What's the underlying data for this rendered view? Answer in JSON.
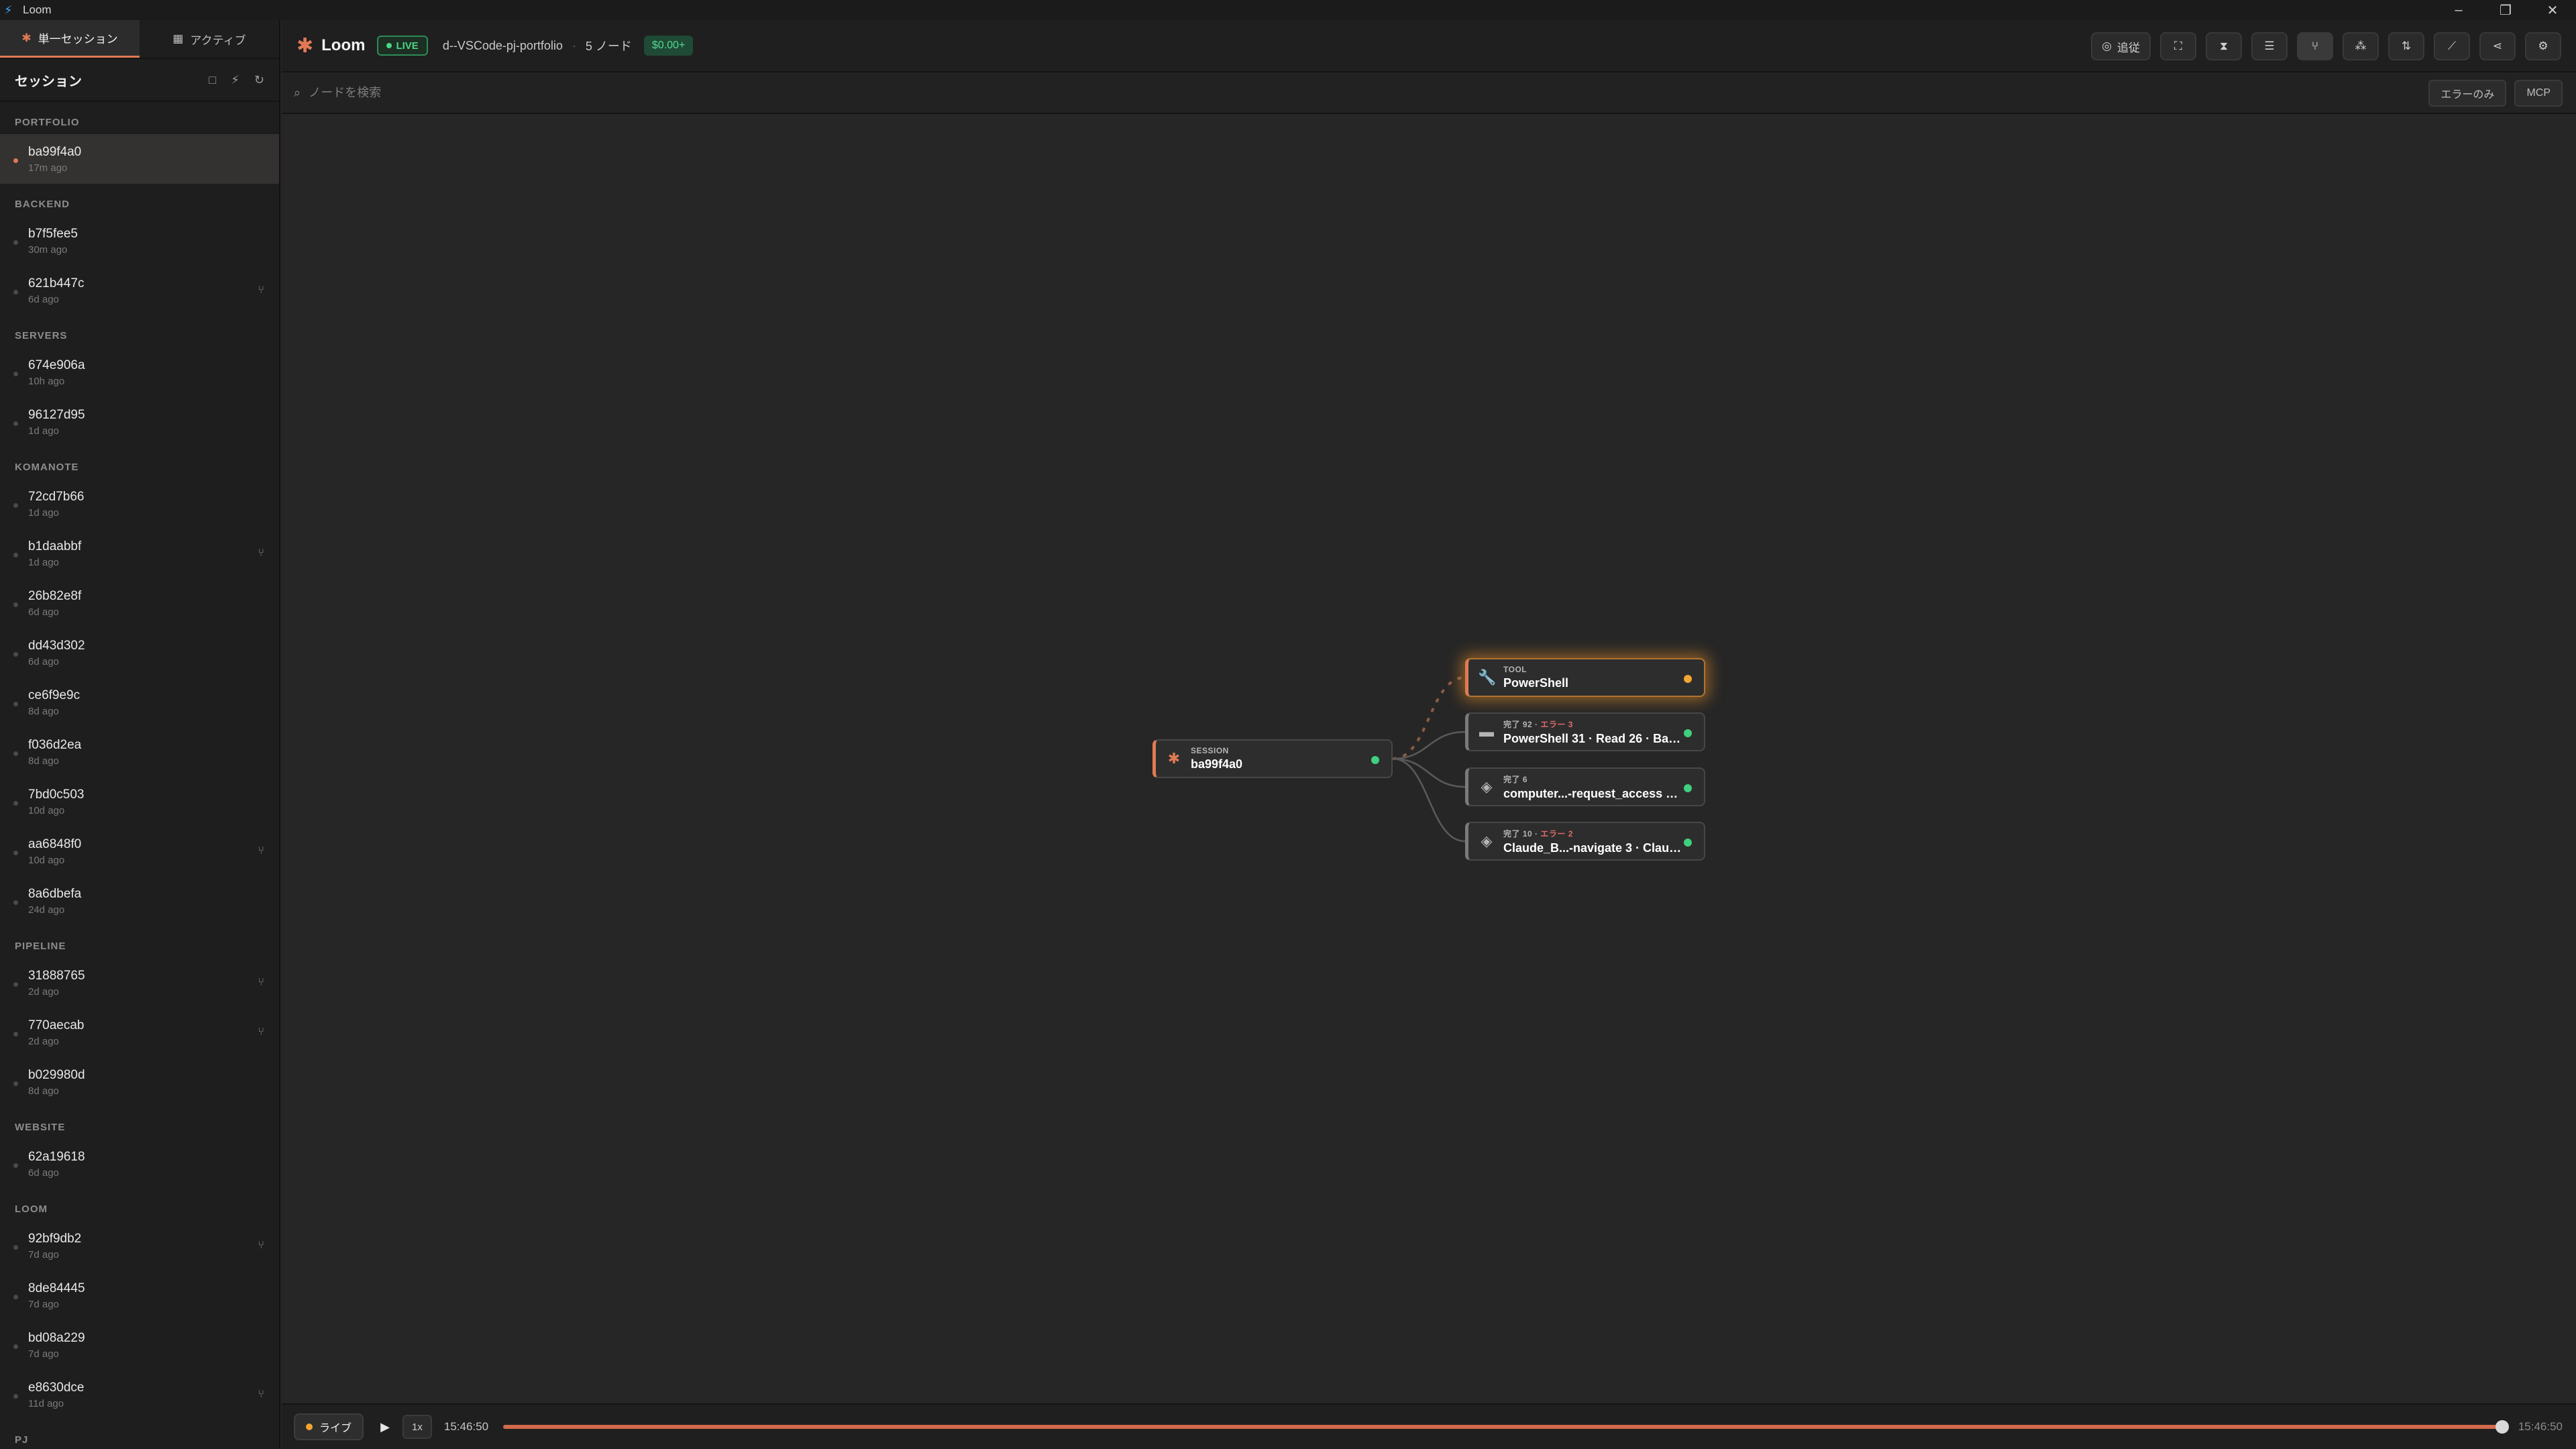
{
  "window": {
    "title": "Loom",
    "controls": [
      "–",
      "❐",
      "✕"
    ]
  },
  "sidebar": {
    "tabs": [
      {
        "label": "単一セッション",
        "icon": "✱",
        "active": true
      },
      {
        "label": "アクティブ",
        "icon": "▦",
        "active": false
      }
    ],
    "header": {
      "title": "セッション",
      "tools": [
        "□",
        "⚡",
        "↻"
      ]
    },
    "groups": [
      {
        "label": "PORTFOLIO",
        "items": [
          {
            "id": "ba99f4a0",
            "age": "17m ago",
            "active": true,
            "branch": false
          }
        ]
      },
      {
        "label": "BACKEND",
        "items": [
          {
            "id": "b7f5fee5",
            "age": "30m ago",
            "branch": false
          },
          {
            "id": "621b447c",
            "age": "6d ago",
            "branch": true
          }
        ]
      },
      {
        "label": "SERVERS",
        "items": [
          {
            "id": "674e906a",
            "age": "10h ago",
            "branch": false
          },
          {
            "id": "96127d95",
            "age": "1d ago",
            "branch": false
          }
        ]
      },
      {
        "label": "KOMANOTE",
        "items": [
          {
            "id": "72cd7b66",
            "age": "1d ago",
            "branch": false
          },
          {
            "id": "b1daabbf",
            "age": "1d ago",
            "branch": true
          },
          {
            "id": "26b82e8f",
            "age": "6d ago",
            "branch": false
          },
          {
            "id": "dd43d302",
            "age": "6d ago",
            "branch": false
          },
          {
            "id": "ce6f9e9c",
            "age": "8d ago",
            "branch": false
          },
          {
            "id": "f036d2ea",
            "age": "8d ago",
            "branch": false
          },
          {
            "id": "7bd0c503",
            "age": "10d ago",
            "branch": false
          },
          {
            "id": "aa6848f0",
            "age": "10d ago",
            "branch": true
          },
          {
            "id": "8a6dbefa",
            "age": "24d ago",
            "branch": false
          }
        ]
      },
      {
        "label": "PIPELINE",
        "items": [
          {
            "id": "31888765",
            "age": "2d ago",
            "branch": true
          },
          {
            "id": "770aecab",
            "age": "2d ago",
            "branch": true
          },
          {
            "id": "b029980d",
            "age": "8d ago",
            "branch": false
          }
        ]
      },
      {
        "label": "WEBSITE",
        "items": [
          {
            "id": "62a19618",
            "age": "6d ago",
            "branch": false
          }
        ]
      },
      {
        "label": "LOOM",
        "items": [
          {
            "id": "92bf9db2",
            "age": "7d ago",
            "branch": true
          },
          {
            "id": "8de84445",
            "age": "7d ago",
            "branch": false
          },
          {
            "id": "bd08a229",
            "age": "7d ago",
            "branch": false
          },
          {
            "id": "e8630dce",
            "age": "11d ago",
            "branch": true
          }
        ]
      },
      {
        "label": "PJ",
        "items": []
      }
    ]
  },
  "header": {
    "brand": "Loom",
    "live_label": "LIVE",
    "project": "d--VSCode-pj-portfolio",
    "separator": "·",
    "node_count": "5 ノード",
    "cost": "$0.00+",
    "toolbar": [
      {
        "name": "follow",
        "icon": "◎",
        "label": "追従",
        "active": false
      },
      {
        "name": "fit-view",
        "icon": "⛶",
        "label": "",
        "active": false
      },
      {
        "name": "collapse",
        "icon": "⧗",
        "label": "",
        "active": false
      },
      {
        "name": "list-view",
        "icon": "☰",
        "label": "",
        "active": false
      },
      {
        "name": "graph-view",
        "icon": "⑂",
        "label": "",
        "active": true
      },
      {
        "name": "cluster-view",
        "icon": "⁂",
        "label": "",
        "active": false
      },
      {
        "name": "sort",
        "icon": "⇅",
        "label": "",
        "active": false
      },
      {
        "name": "chart-view",
        "icon": "⟋",
        "label": "",
        "active": false
      },
      {
        "name": "share",
        "icon": "⋖",
        "label": "",
        "active": false
      },
      {
        "name": "settings",
        "icon": "⚙",
        "label": "",
        "active": false
      }
    ]
  },
  "search": {
    "placeholder": "ノードを検索",
    "filters": [
      "エラーのみ",
      "MCP"
    ]
  },
  "graph": {
    "session": {
      "kind": "SESSION",
      "title": "ba99f4a0",
      "icon": "✱",
      "status": "done"
    },
    "children": [
      {
        "kind": "TOOL",
        "title": "PowerShell",
        "icon": "🔧",
        "status": "running",
        "type": "tool",
        "done_text": "",
        "err_text": ""
      },
      {
        "kind": "",
        "done_text": "完了 92",
        "err_text": "エラー 3",
        "title": "PowerShell 31 · Read 26 · Bas...",
        "icon": "▬",
        "status": "done",
        "type": "group"
      },
      {
        "kind": "",
        "done_text": "完了 6",
        "err_text": "",
        "title": "computer...-request_access 2 ·...",
        "icon": "◈",
        "status": "done",
        "type": "group"
      },
      {
        "kind": "",
        "done_text": "完了 10",
        "err_text": "エラー 2",
        "title": "Claude_B...-navigate 3 · Claud...",
        "icon": "◈",
        "status": "done",
        "type": "group"
      }
    ]
  },
  "timeline": {
    "live_label": "ライブ",
    "play_icon": "▶",
    "speed": "1x",
    "start_time": "15:46:50",
    "end_time": "15:46:50",
    "progress": 1.0
  }
}
